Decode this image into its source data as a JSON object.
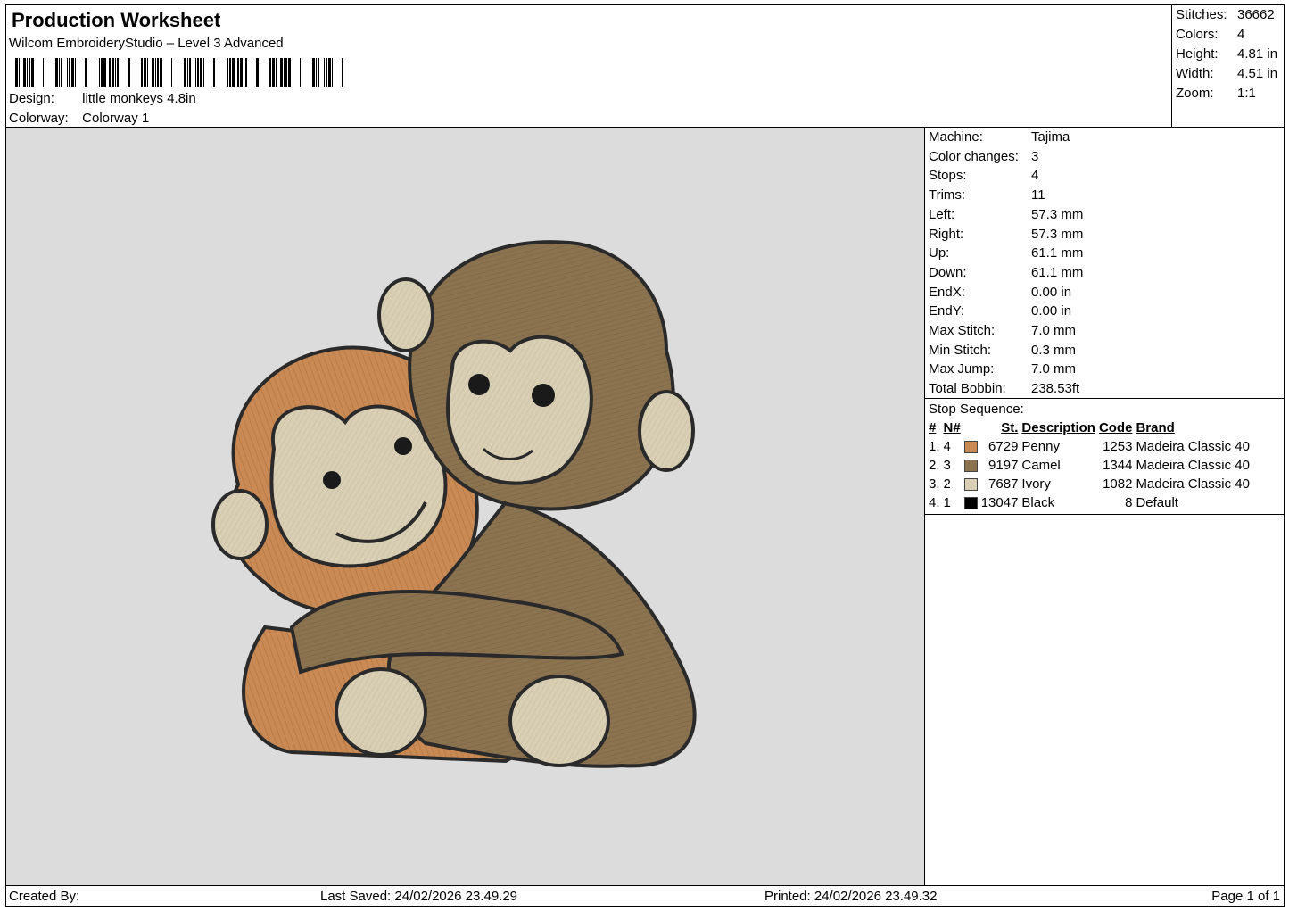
{
  "header": {
    "title": "Production Worksheet",
    "software": "Wilcom EmbroideryStudio – Level 3 Advanced",
    "design_label": "Design:",
    "design_value": "little monkeys 4.8in",
    "colorway_label": "Colorway:",
    "colorway_value": "Colorway 1"
  },
  "summary": [
    {
      "label": "Stitches:",
      "value": "36662"
    },
    {
      "label": "Colors:",
      "value": "4"
    },
    {
      "label": "Height:",
      "value": "4.81 in"
    },
    {
      "label": "Width:",
      "value": "4.51 in"
    },
    {
      "label": "Zoom:",
      "value": "1:1"
    }
  ],
  "specs": [
    {
      "label": "Machine:",
      "value": "Tajima"
    },
    {
      "label": "Color changes:",
      "value": "3"
    },
    {
      "label": "Stops:",
      "value": "4"
    },
    {
      "label": "Trims:",
      "value": "11"
    },
    {
      "label": "Left:",
      "value": "57.3 mm"
    },
    {
      "label": "Right:",
      "value": "57.3 mm"
    },
    {
      "label": "Up:",
      "value": "61.1 mm"
    },
    {
      "label": "Down:",
      "value": "61.1 mm"
    },
    {
      "label": "EndX:",
      "value": "0.00 in"
    },
    {
      "label": "EndY:",
      "value": "0.00 in"
    },
    {
      "label": "Max Stitch:",
      "value": "7.0 mm"
    },
    {
      "label": "Min Stitch:",
      "value": "0.3 mm"
    },
    {
      "label": "Max Jump:",
      "value": "7.0 mm"
    },
    {
      "label": "Total Bobbin:",
      "value": "238.53ft"
    }
  ],
  "stop_sequence": {
    "heading": "Stop Sequence:",
    "columns": [
      "#",
      "N#",
      "St.",
      "Description",
      "Code",
      "Brand"
    ],
    "rows": [
      {
        "idx": "1.",
        "n": "4",
        "color": "#c98a55",
        "st": "6729",
        "desc": "Penny",
        "code": "1253",
        "brand": "Madeira Classic 40"
      },
      {
        "idx": "2.",
        "n": "3",
        "color": "#8b7350",
        "st": "9197",
        "desc": "Camel",
        "code": "1344",
        "brand": "Madeira Classic 40"
      },
      {
        "idx": "3.",
        "n": "2",
        "color": "#d8cfb5",
        "st": "7687",
        "desc": "Ivory",
        "code": "1082",
        "brand": "Madeira Classic 40"
      },
      {
        "idx": "4.",
        "n": "1",
        "color": "#000000",
        "st": "13047",
        "desc": "Black",
        "code": "8",
        "brand": "Default"
      }
    ]
  },
  "footer": {
    "created_by": "Created By:",
    "last_saved": "Last Saved: 24/02/2026 23.49.29",
    "printed": "Printed: 24/02/2026 23.49.32",
    "page": "Page 1 of 1"
  },
  "colors": {
    "canvas_bg": "#dcdcdc",
    "penny": "#c98a55",
    "camel": "#8b7350",
    "ivory": "#d8cfb5",
    "outline": "#2a2a2a"
  }
}
